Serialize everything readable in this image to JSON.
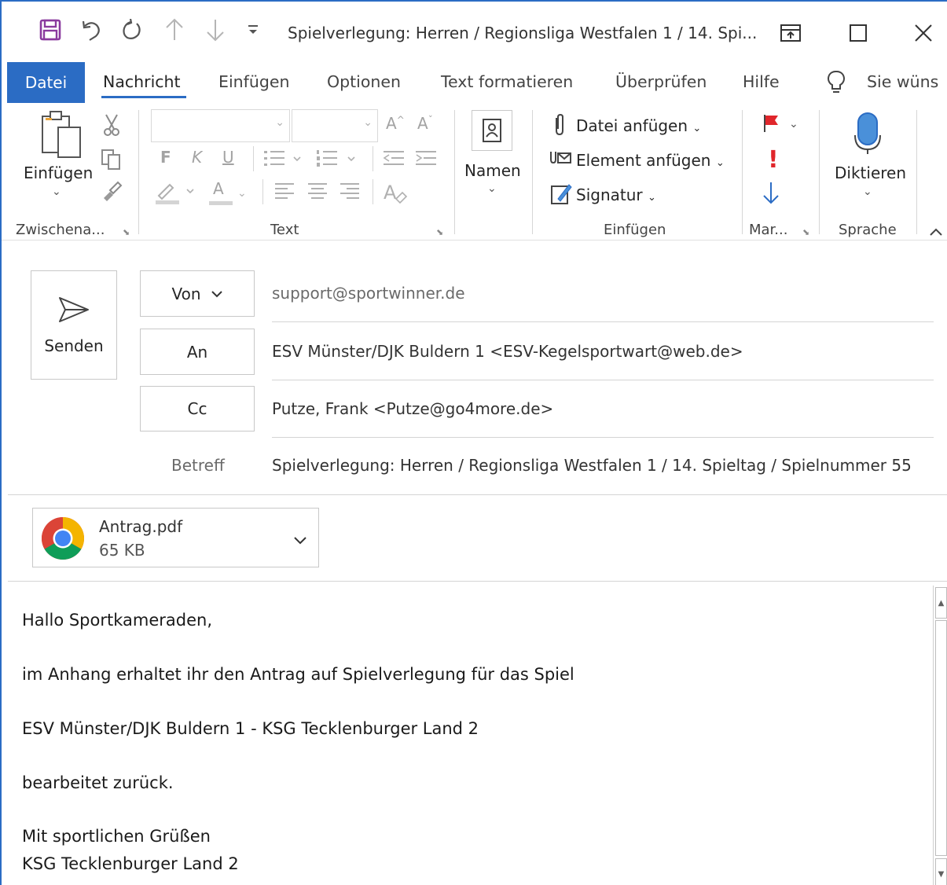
{
  "window": {
    "title": "Spielverlegung: Herren / Regionsliga Westfalen 1 / 14. Spi...",
    "quick_access": [
      "save-icon",
      "undo-icon",
      "redo-icon",
      "up-arrow-icon",
      "down-arrow-icon",
      "customize-icon"
    ],
    "controls": [
      "ribbon-display-icon",
      "maximize-icon",
      "close-icon"
    ]
  },
  "menu": {
    "file_tab": "Datei",
    "tabs": [
      "Nachricht",
      "Einfügen",
      "Optionen",
      "Text formatieren",
      "Überprüfen",
      "Hilfe"
    ],
    "active_tab": "Nachricht",
    "search": "Sie wüns"
  },
  "ribbon": {
    "clipboard": {
      "paste": "Einfügen",
      "label": "Zwischena..."
    },
    "text": {
      "label": "Text",
      "bold": "F",
      "italic": "K",
      "underline": "U",
      "grow": "A",
      "shrink": "A",
      "font_color": "A"
    },
    "names": {
      "button": "Namen"
    },
    "insert": {
      "attach_file": "Datei anfügen",
      "attach_item": "Element anfügen",
      "signature": "Signatur",
      "label": "Einfügen"
    },
    "tags": {
      "label": "Mar..."
    },
    "voice": {
      "dictate": "Diktieren",
      "label": "Sprache"
    }
  },
  "compose": {
    "send": "Senden",
    "from_label": "Von",
    "from_value": "support@sportwinner.de",
    "to_label": "An",
    "to_value": "ESV Münster/DJK Buldern 1 <ESV-Kegelsportwart@web.de>",
    "cc_label": "Cc",
    "cc_value": "Putze, Frank <Putze@go4more.de>",
    "subject_label": "Betreff",
    "subject_value": "Spielverlegung: Herren / Regionsliga Westfalen 1 / 14. Spieltag / Spielnummer 55"
  },
  "attachment": {
    "name": "Antrag.pdf",
    "size": "65 KB",
    "icon": "chrome-icon"
  },
  "body": {
    "lines": [
      "Hallo Sportkameraden,",
      "im Anhang erhaltet ihr den Antrag auf Spielverlegung für das Spiel",
      "ESV Münster/DJK Buldern 1 - KSG Tecklenburger Land 2",
      "bearbeitet zurück.",
      "Mit sportlichen Grüßen",
      "KSG Tecklenburger Land 2"
    ]
  },
  "colors": {
    "accent": "#2b6cc4",
    "save_icon": "#8a3a9e",
    "flag": "#e0262b",
    "importance": "#e0262b",
    "low_importance": "#2b6cc4",
    "mic": "#4a90d9"
  }
}
